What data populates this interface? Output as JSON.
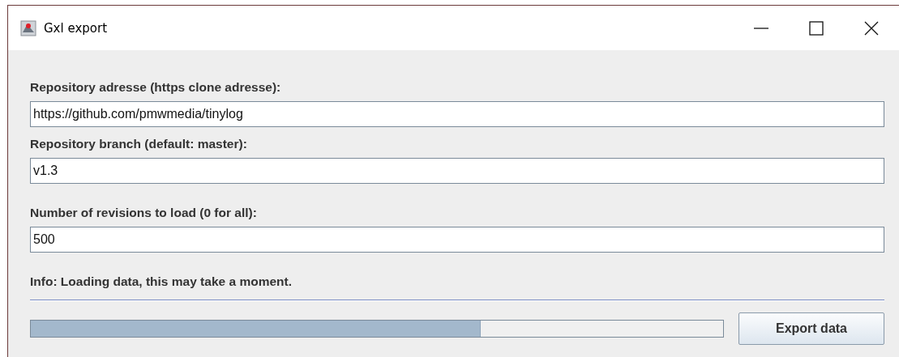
{
  "window": {
    "title": "Gxl export"
  },
  "fields": [
    {
      "label": "Repository adresse (https clone adresse):",
      "value": "https://github.com/pmwmedia/tinylog"
    },
    {
      "label": "Repository branch (default: master):",
      "value": "v1.3"
    },
    {
      "label": "Number of revisions to load (0 for all):",
      "value": "500"
    }
  ],
  "info": "Info: Loading data, this may take a moment.",
  "progress": {
    "level": 0.65
  },
  "buttons": [
    "Export data"
  ]
}
